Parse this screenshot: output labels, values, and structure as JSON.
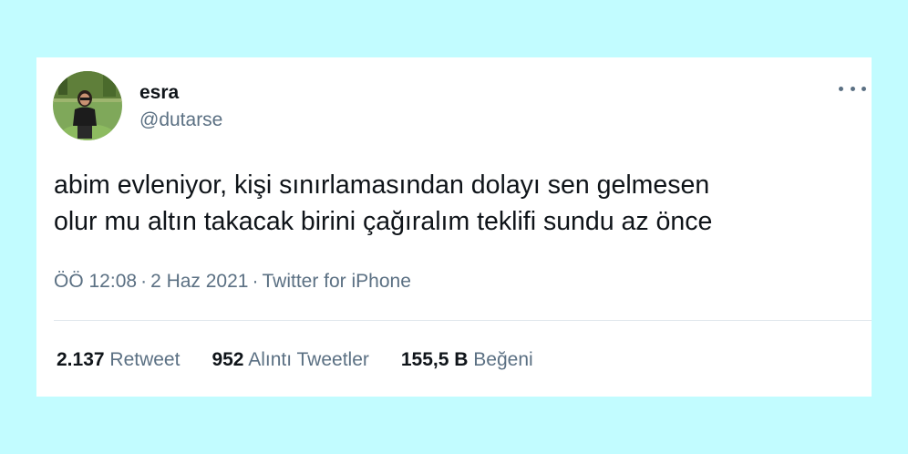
{
  "user": {
    "display_name": "esra",
    "handle": "@dutarse"
  },
  "tweet": {
    "text": "abim evleniyor, kişi sınırlamasından dolayı sen gelmesen\nolur mu altın takacak birini çağıralım teklifi sundu az önce",
    "time": "ÖÖ 12:08",
    "separator": "·",
    "date": "2 Haz 2021",
    "source": "Twitter for iPhone"
  },
  "stats": {
    "retweets": {
      "count": "2.137",
      "label": "Retweet"
    },
    "quotes": {
      "count": "952",
      "label": "Alıntı Tweetler"
    },
    "likes": {
      "count": "155,5 B",
      "label": "Beğeni"
    }
  },
  "icons": {
    "more": "more-horizontal-icon"
  },
  "colors": {
    "background": "#c2fcff",
    "card": "#ffffff",
    "text_primary": "#0f1419",
    "text_secondary": "#5b7083",
    "divider": "#e1e8ed"
  }
}
